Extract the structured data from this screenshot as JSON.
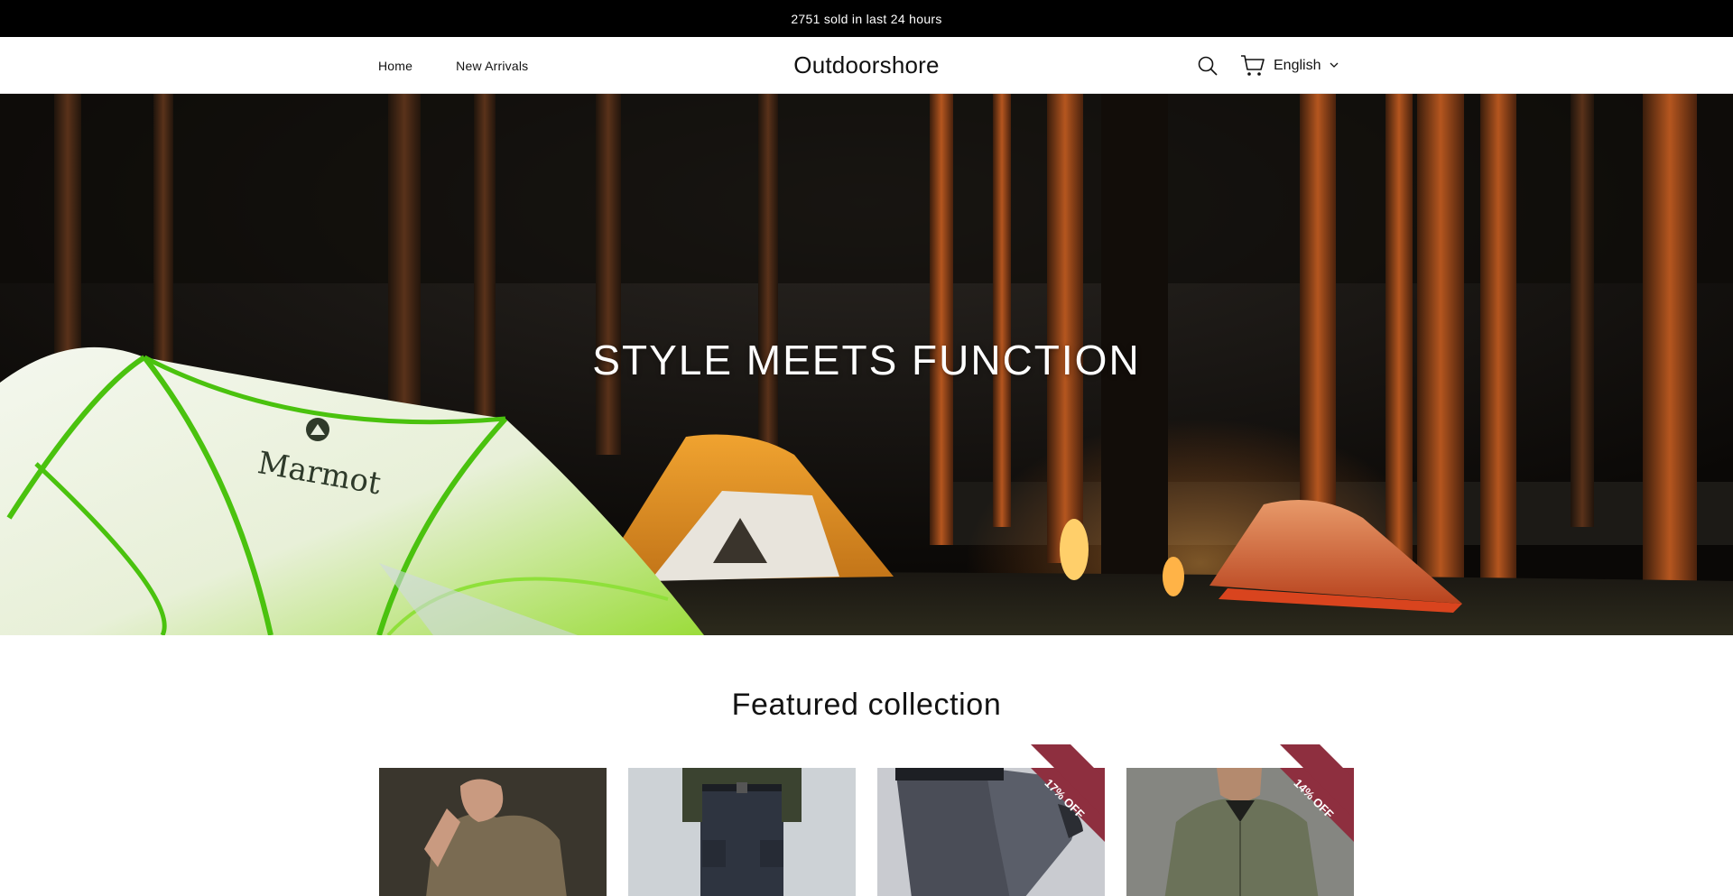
{
  "announcement": {
    "text": "2751 sold in last 24 hours"
  },
  "header": {
    "nav": [
      {
        "label": "Home"
      },
      {
        "label": "New Arrivals"
      }
    ],
    "logo": "Outdoorshore",
    "language": {
      "selected": "English"
    },
    "icons": {
      "search": "search-icon",
      "cart": "cart-icon",
      "language_toggle": "chevron-down-icon"
    }
  },
  "hero": {
    "title": "STYLE MEETS FUNCTION",
    "tent_logo": "Marmot"
  },
  "featured": {
    "title": "Featured collection",
    "products": [
      {
        "badge": "",
        "image": "man in olive t-shirt"
      },
      {
        "badge": "",
        "image": "dark cargo pants"
      },
      {
        "badge": "17% OFF",
        "image": "grey tactical pants"
      },
      {
        "badge": "14% OFF",
        "image": "green softshell jacket"
      }
    ]
  },
  "colors": {
    "announce_bg": "#000000",
    "badge": "#8e2f3f",
    "text": "#121212"
  }
}
